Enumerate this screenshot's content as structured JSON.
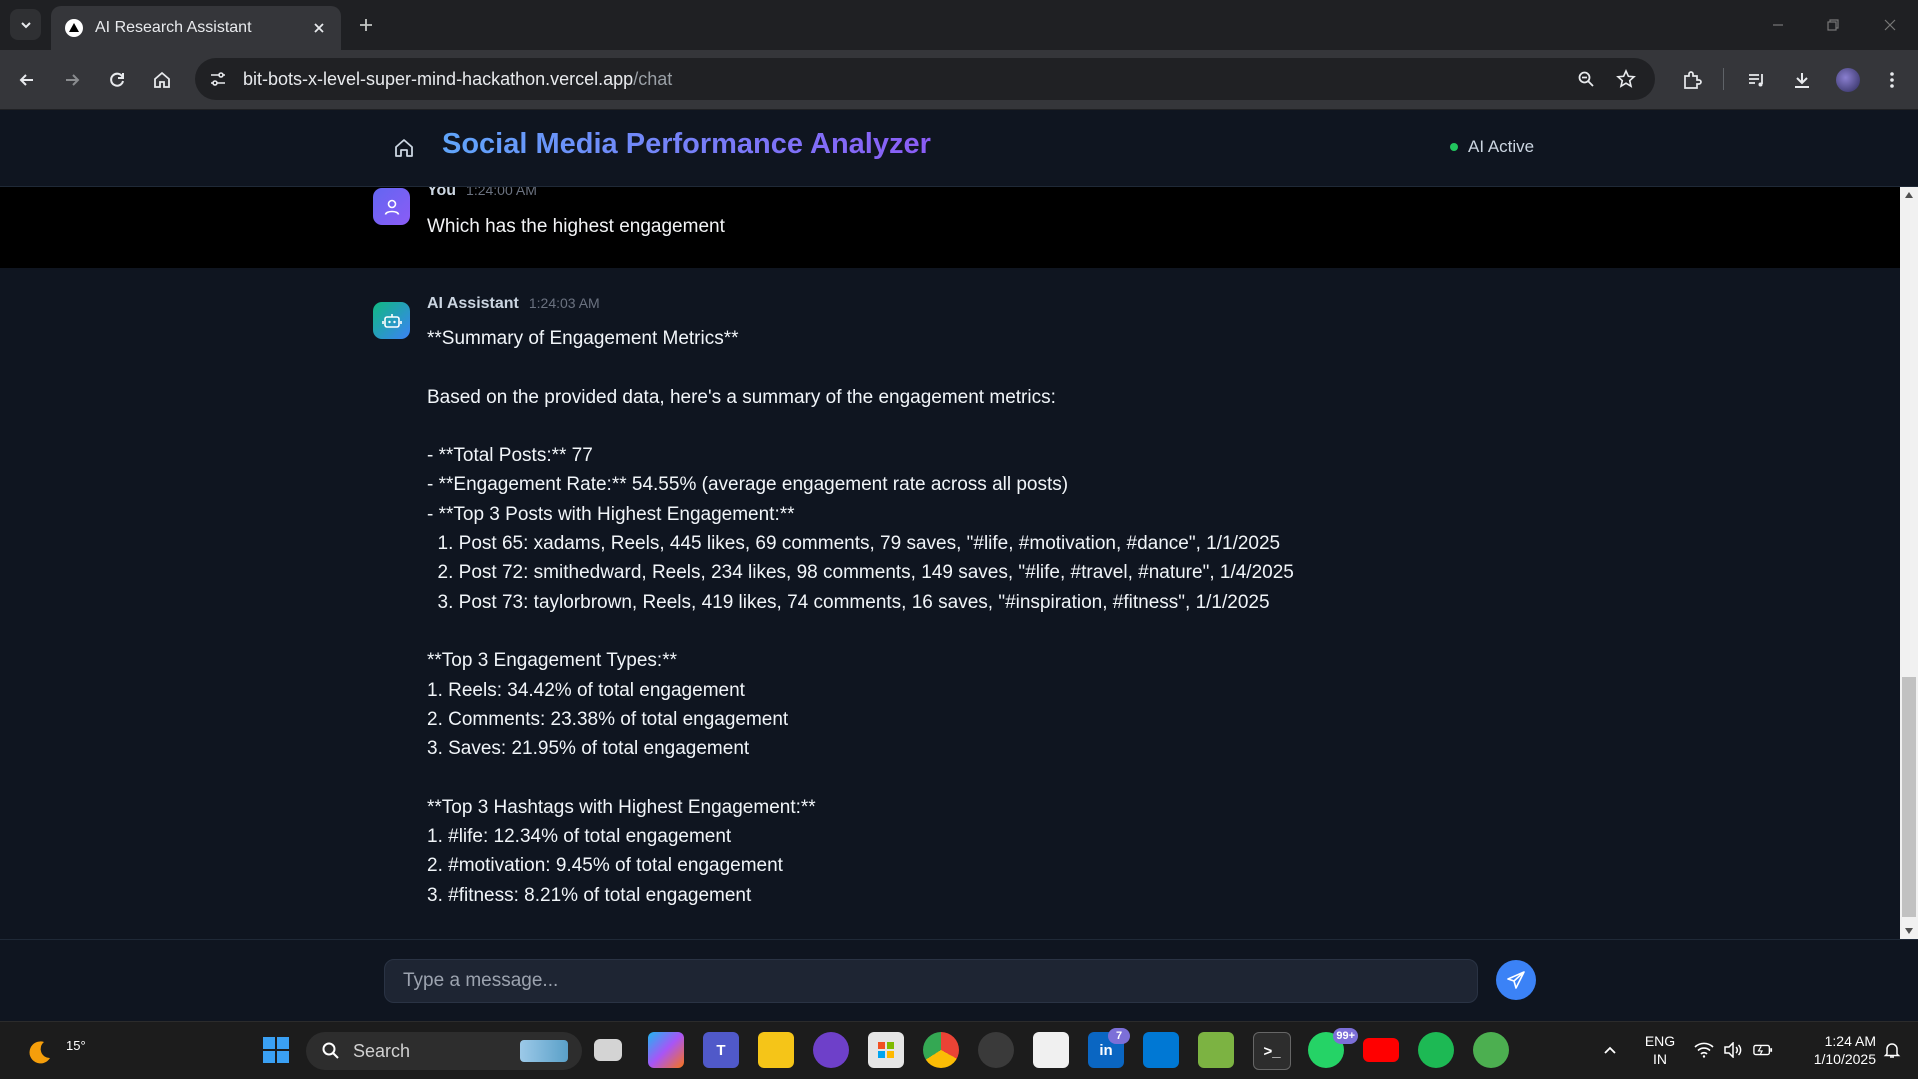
{
  "browser": {
    "tab_title": "AI Research Assistant",
    "url_host": "bit-bots-x-level-super-mind-hackathon.vercel.app",
    "url_path": "/chat"
  },
  "header": {
    "title": "Social Media Performance Analyzer",
    "status": "AI Active",
    "status_color": "#22c55e"
  },
  "messages": {
    "user": {
      "sender": "You",
      "time": "1:24:00 AM",
      "text": "Which has the highest engagement"
    },
    "assistant": {
      "sender": "AI Assistant",
      "time": "1:24:03 AM",
      "lines": [
        "**Summary of Engagement Metrics**",
        "",
        "Based on the provided data, here's a summary of the engagement metrics:",
        "",
        "- **Total Posts:** 77",
        "- **Engagement Rate:** 54.55% (average engagement rate across all posts)",
        "- **Top 3 Posts with Highest Engagement:**",
        "  1. Post 65: xadams, Reels, 445 likes, 69 comments, 79 saves, \"#life, #motivation, #dance\", 1/1/2025",
        "  2. Post 72: smithedward, Reels, 234 likes, 98 comments, 149 saves, \"#life, #travel, #nature\", 1/4/2025",
        "  3. Post 73: taylorbrown, Reels, 419 likes, 74 comments, 16 saves, \"#inspiration, #fitness\", 1/1/2025",
        "",
        "**Top 3 Engagement Types:**",
        "1. Reels: 34.42% of total engagement",
        "2. Comments: 23.38% of total engagement",
        "3. Saves: 21.95% of total engagement",
        "",
        "**Top 3 Hashtags with Highest Engagement:**",
        "1. #life: 12.34% of total engagement",
        "2. #motivation: 9.45% of total engagement",
        "3. #fitness: 8.21% of total engagement"
      ]
    }
  },
  "composer": {
    "placeholder": "Type a message..."
  },
  "taskbar": {
    "weather_temp": "15°",
    "search_label": "Search",
    "linkedin_badge": "7",
    "whatsapp_badge": "99+",
    "lang_line1": "ENG",
    "lang_line2": "IN",
    "clock_time": "1:24 AM",
    "clock_date": "1/10/2025"
  },
  "colors": {
    "accent": "#3b82f6",
    "title_gradient_start": "#60a5fa",
    "title_gradient_end": "#8b5cf6"
  }
}
